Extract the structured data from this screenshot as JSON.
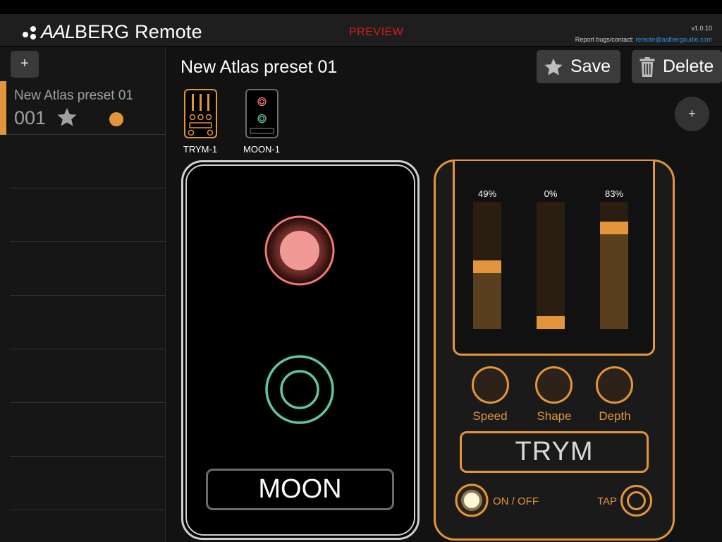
{
  "header": {
    "app_name_prefix": "AAL",
    "app_name_suffix": "BERG Remote",
    "preview_label": "PREVIEW",
    "version": "v1.0.10",
    "contact_prefix": "Report bugs/contact: ",
    "contact_email": "remote@aalbergaudio.com"
  },
  "sidebar": {
    "add_label": "+",
    "presets": [
      {
        "name": "New Atlas preset 01",
        "number": "001",
        "starred": true,
        "active": true
      }
    ]
  },
  "main": {
    "preset_title": "New Atlas preset 01",
    "save_label": "Save",
    "delete_label": "Delete",
    "add_device_label": "+",
    "devices": [
      {
        "label": "TRYM-1"
      },
      {
        "label": "MOON-1"
      }
    ]
  },
  "moon": {
    "name": "MOON",
    "colors": {
      "frame": "#cfcfcf",
      "red": "#f07a72",
      "green": "#5fc79a"
    }
  },
  "trym": {
    "name": "TRYM",
    "sliders": [
      {
        "label": "Speed",
        "percent_text": "49%",
        "value": 0.49
      },
      {
        "label": "Shape",
        "percent_text": "0%",
        "value": 0.0
      },
      {
        "label": "Depth",
        "percent_text": "83%",
        "value": 0.83
      }
    ],
    "on_off_label": "ON / OFF",
    "tap_label": "TAP",
    "colors": {
      "accent": "#e2953a"
    }
  }
}
